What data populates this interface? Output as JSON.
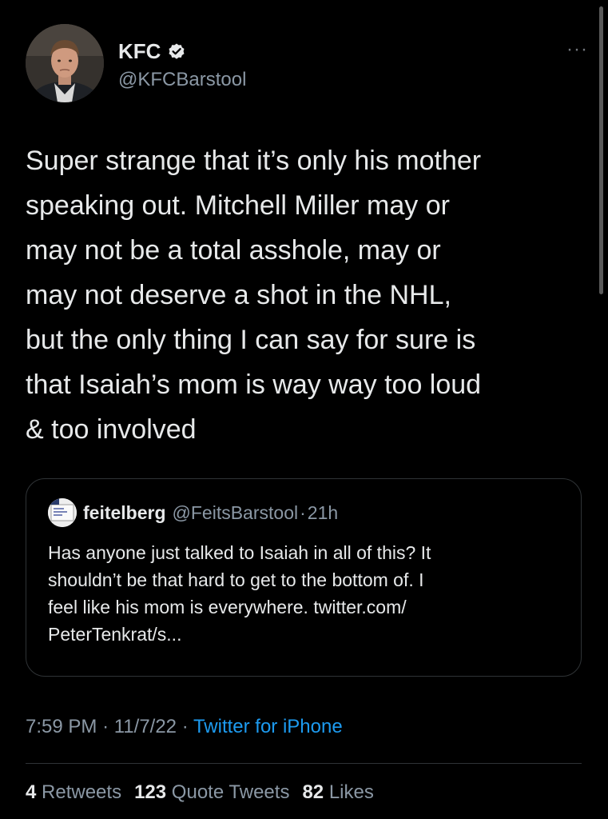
{
  "author": {
    "display_name": "KFC",
    "handle": "@KFCBarstool",
    "verified": true,
    "avatar_icon": "profile-photo"
  },
  "more_label": "···",
  "tweet": {
    "lines": [
      "Super strange that it’s only his mother",
      "speaking out. Mitchell Miller may or",
      "may not be a total asshole, may or",
      "may not deserve a shot in the NHL,",
      "but the only thing I can say for sure is",
      "that Isaiah’s mom is way way too loud",
      "& too involved"
    ]
  },
  "quoted_tweet": {
    "display_name": "feitelberg",
    "handle": "@FeitsBarstool",
    "separator": "·",
    "time": "21h",
    "lines": [
      "Has anyone just talked to Isaiah in all of this? It",
      "shouldn’t be that hard to get to the bottom of. I",
      "feel like his mom is everywhere. twitter.com/",
      "PeterTenkrat/s..."
    ]
  },
  "meta": {
    "time": "7:59 PM",
    "separator": "·",
    "date": "11/7/22",
    "source": "Twitter for iPhone"
  },
  "stats": {
    "retweets_count": "4",
    "retweets_label": "Retweets",
    "quotes_count": "123",
    "quotes_label": "Quote Tweets",
    "likes_count": "82",
    "likes_label": "Likes"
  },
  "colors": {
    "background": "#000000",
    "text": "#e7e9ea",
    "secondary": "#8b98a5",
    "link": "#1d9bf0",
    "verified_badge": "#e7e9ea",
    "border": "#2f3336"
  }
}
